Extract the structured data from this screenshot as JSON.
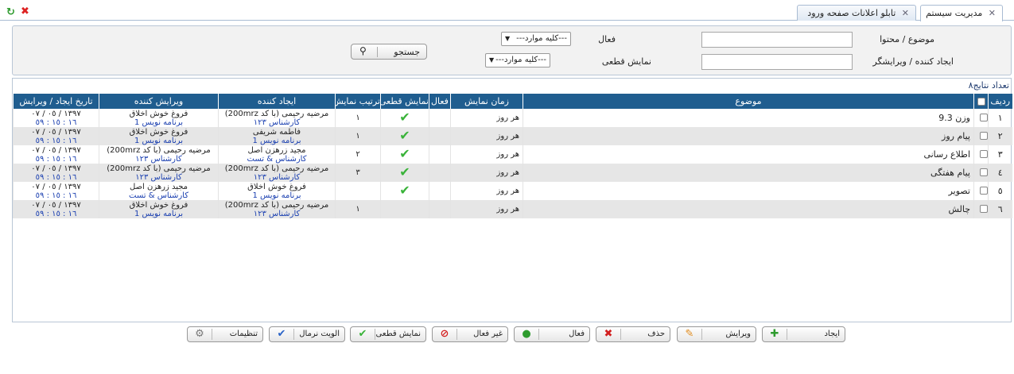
{
  "window": {
    "refresh_icon": "↻",
    "close_icon": "✖"
  },
  "tabs": [
    {
      "label": "مدیریت سیستم",
      "close": "✕"
    },
    {
      "label": "تابلو اعلانات صفحه ورود",
      "close": "✕"
    }
  ],
  "filter": {
    "subject_label": "موضوع / محتوا",
    "creator_label": "ایجاد کننده / ویرایشگر",
    "active_label": "فعال",
    "active_value": "---کلیه موارد---",
    "final_label": "نمایش قطعی",
    "final_value": "---کلیه موارد---",
    "search_label": "جستجو"
  },
  "grid": {
    "count_label": "تعداد نتایج۸",
    "columns": {
      "row": "ردیف",
      "subject": "موضوع",
      "show_time": "زمان نمایش",
      "active": "فعال",
      "final": "نمایش قطعی",
      "order": "ترتیب نمایش",
      "creator": "ایجاد کننده",
      "editor": "ویرایش کننده",
      "date": "تاریخ ایجاد / ویرایش"
    },
    "rows": [
      {
        "num": "١",
        "subject": "وزن 9.3",
        "show_time": "هر روز",
        "final": "✔",
        "order": "١",
        "creator": "مرضیه رحیمی (با کد 200mrz)",
        "creator_role": "کارشناس ١٢٣",
        "editor": "فروغ خوش اخلاق",
        "editor_role": "برنامه نویس 1",
        "date": "١٣٩٧ / ٠٥ / ٠٧",
        "time": "١٦ : ١٥ : ٥٩"
      },
      {
        "num": "٢",
        "subject": "پیام روز",
        "show_time": "هر روز",
        "final": "✔",
        "order": "١",
        "creator": "فاطمه شریفی",
        "creator_role": "برنامه نویس 1",
        "editor": "فروغ خوش اخلاق",
        "editor_role": "برنامه نویس 1",
        "date": "١٣٩٧ / ٠٥ / ٠٧",
        "time": "١٦ : ١٥ : ٥٩"
      },
      {
        "num": "٣",
        "subject": "اطلاع رسانی",
        "show_time": "هر روز",
        "final": "✔",
        "order": "٢",
        "creator": "مجید زرهزن اصل",
        "creator_role": "کارشناس & تست",
        "editor": "مرضیه رحیمی (با کد 200mrz)",
        "editor_role": "کارشناس ١٢٣",
        "date": "١٣٩٧ / ٠٥ / ٠٧",
        "time": "١٦ : ١٥ : ٥٩"
      },
      {
        "num": "٤",
        "subject": "پیام هفتگی",
        "show_time": "هر روز",
        "final": "✔",
        "order": "٣",
        "creator": "مرضیه رحیمی (با کد 200mrz)",
        "creator_role": "کارشناس ١٢٣",
        "editor": "مرضیه رحیمی (با کد 200mrz)",
        "editor_role": "کارشناس ١٢٣",
        "date": "١٣٩٧ / ٠٥ / ٠٧",
        "time": "١٦ : ١٥ : ٥٩"
      },
      {
        "num": "٥",
        "subject": "تصویر",
        "show_time": "هر روز",
        "final": "✔",
        "order": "",
        "creator": "فروغ خوش اخلاق",
        "creator_role": "برنامه نویس 1",
        "editor": "مجید زرهزن اصل",
        "editor_role": "کارشناس & تست",
        "date": "١٣٩٧ / ٠٥ / ٠٧",
        "time": "١٦ : ١٥ : ٥٩"
      },
      {
        "num": "٦",
        "subject": "چالش",
        "show_time": "هر روز",
        "final": "",
        "order": "١",
        "creator": "مرضیه رحیمی (با کد 200mrz)",
        "creator_role": "کارشناس ١٢٣",
        "editor": "فروغ خوش اخلاق",
        "editor_role": "برنامه نویس 1",
        "date": "١٣٩٧ / ٠٥ / ٠٧",
        "time": "١٦ : ١٥ : ٥٩"
      }
    ]
  },
  "toolbar": {
    "create": "ایجاد",
    "edit": "ویرایش",
    "delete": "حذف",
    "activate": "فعال",
    "deactivate": "غیر فعال",
    "final_show": "نمایش قطعی",
    "normal_priority": "الویت نرمال",
    "settings": "تنظیمات"
  },
  "colors": {
    "header_bg": "#1f5d8f",
    "check_green": "#39b339",
    "link_blue": "#1a3fb0"
  }
}
